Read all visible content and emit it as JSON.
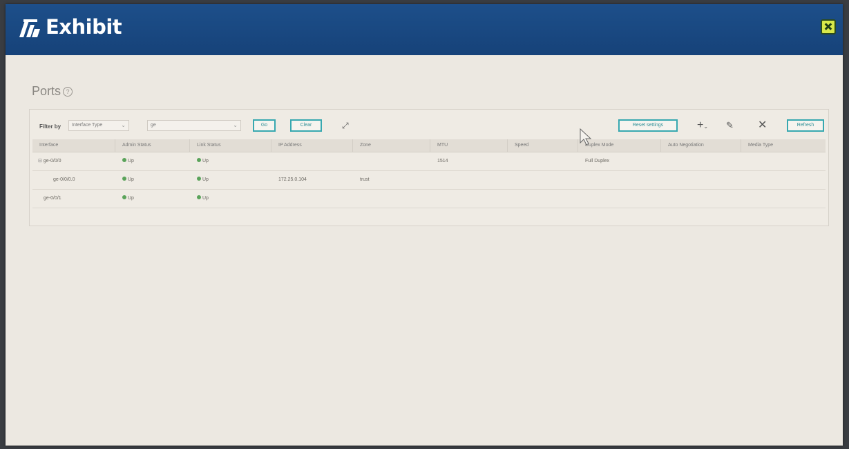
{
  "window": {
    "title": "Exhibit",
    "logo_icon": "exhibit-logo-icon",
    "close_icon": "close-icon",
    "close_color": "#d8e84a"
  },
  "page": {
    "title": "Ports",
    "help_icon": "help-icon"
  },
  "toolbar": {
    "filter_label": "Filter by",
    "filter_field": "Interface Type",
    "filter_value": "ge",
    "go_label": "Go",
    "clear_label": "Clear",
    "expand_icon": "expand-icon",
    "reset_settings_label": "Reset settings",
    "add_icon": "add-icon",
    "edit_icon": "edit-icon",
    "delete_icon": "delete-icon",
    "refresh_label": "Refresh"
  },
  "columns": [
    "Interface",
    "Admin Status",
    "Link Status",
    "IP Address",
    "Zone",
    "MTU",
    "Speed",
    "Duplex Mode",
    "Auto Negotiation",
    "Media Type"
  ],
  "rows": [
    {
      "interface": "ge-0/0/0",
      "admin_status": "Up",
      "link_status": "Up",
      "ip_address": "",
      "zone": "",
      "mtu": "1514",
      "speed": "",
      "duplex": "Full Duplex",
      "auto_neg": "",
      "media": ""
    },
    {
      "interface": "ge-0/0/0.0",
      "admin_status": "Up",
      "link_status": "Up",
      "ip_address": "172.25.0.104",
      "zone": "trust",
      "mtu": "",
      "speed": "",
      "duplex": "",
      "auto_neg": "",
      "media": ""
    },
    {
      "interface": "ge-0/0/1",
      "admin_status": "Up",
      "link_status": "Up",
      "ip_address": "",
      "zone": "",
      "mtu": "",
      "speed": "",
      "duplex": "",
      "auto_neg": "",
      "media": ""
    }
  ],
  "colors": {
    "titlebar": "#1d4f8a",
    "accent_button_border": "#37a8b0",
    "status_up": "#5aa35a"
  }
}
